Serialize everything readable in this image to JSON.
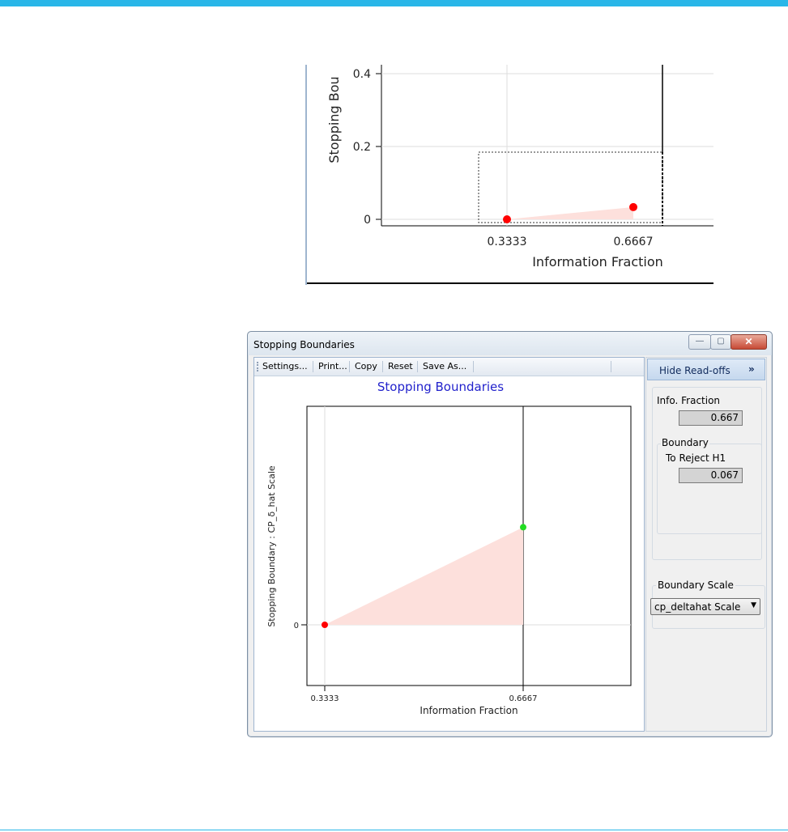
{
  "zoom_chart": {
    "y_axis_label": "Stopping Bou",
    "x_axis_label": "Information Fraction",
    "y_ticks": [
      "0.4",
      "0.2",
      "0"
    ],
    "x_ticks": [
      "0.3333",
      "0.6667"
    ],
    "points": [
      {
        "x": 0.3333,
        "y": 0.0
      },
      {
        "x": 0.6667,
        "y": 0.067
      }
    ],
    "colors": {
      "point": "#ff0000",
      "fill": "#fde0dc"
    }
  },
  "window": {
    "title": "Stopping Boundaries",
    "buttons": {
      "minimize": "—",
      "maximize": "▢",
      "close": "✕"
    },
    "toolbar": {
      "settings": "Settings...",
      "print": "Print...",
      "copy": "Copy",
      "reset": "Reset",
      "save_as": "Save As..."
    },
    "chart_title": "Stopping Boundaries",
    "chart": {
      "y_axis_label": "Stopping Boundary : CP_δ_hat Scale",
      "x_axis_label": "Information Fraction",
      "y_ticks": [
        "0"
      ],
      "x_ticks": [
        "0.3333",
        "0.6667"
      ],
      "points": [
        {
          "x": 0.3333,
          "y": 0.0,
          "color": "#ff0000"
        },
        {
          "x": 0.6667,
          "y": 0.067,
          "color": "#22dd22"
        }
      ],
      "colors": {
        "title": "#2222cc",
        "fill": "#fde0dc"
      }
    },
    "readoffs": {
      "hide_button": "Hide Read-offs",
      "hide_chevron": "»",
      "info_fraction_label": "Info. Fraction",
      "info_fraction_value": "0.667",
      "boundary_group": "Boundary",
      "to_reject_label": "To Reject H1",
      "to_reject_value": "0.067",
      "boundary_scale_label": "Boundary Scale",
      "boundary_scale_value": "cp_deltahat Scale"
    }
  }
}
